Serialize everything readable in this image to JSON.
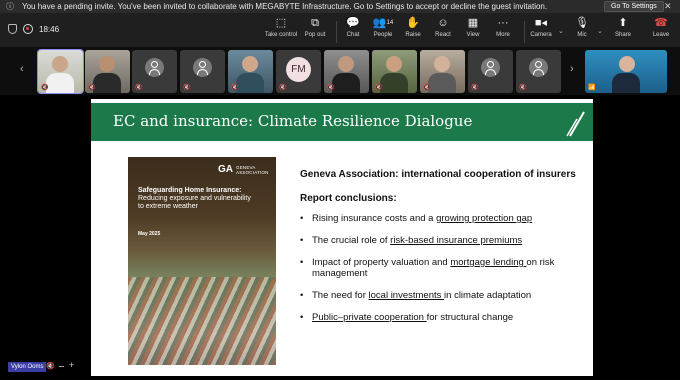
{
  "banner": {
    "message": "You have a pending invite. You've been invited to collaborate with MEGABYTE Infrastructure. Go to Settings to accept or decline the guest invitation.",
    "button": "Go To Settings"
  },
  "toolbar": {
    "time": "18:46",
    "take_control": "Take control",
    "pop_out": "Pop out",
    "chat": "Chat",
    "people": "People",
    "people_count": "14",
    "raise": "Raise",
    "react": "React",
    "view": "View",
    "more": "More",
    "camera": "Camera",
    "mic": "Mic",
    "share": "Share",
    "leave": "Leave"
  },
  "participants": {
    "initials": "FM",
    "presenter_name": "Vylon Ooms"
  },
  "slide": {
    "title": "EC and insurance: Climate Resilience Dialogue",
    "cover": {
      "logo_line1": "GENEVA",
      "logo_line2": "ASSOCIATION",
      "title_bold": "Safeguarding Home Insurance:",
      "title_rest": " Reducing exposure and vulnerability to extreme weather",
      "date": "May 2025"
    },
    "heading": "Geneva Association: international cooperation of insurers",
    "subheading": "Report conclusions:",
    "bullets": [
      {
        "pre": "Rising insurance costs and a ",
        "link": "growing protection gap",
        "post": ""
      },
      {
        "pre": "The crucial role of ",
        "link": "risk-based insurance premiums",
        "post": ""
      },
      {
        "pre": "Impact of property valuation and ",
        "link": "mortgage lending ",
        "post": "on risk management"
      },
      {
        "pre": "The need for ",
        "link": "local investments ",
        "post": "in climate adaptation"
      },
      {
        "pre": "",
        "link": "Public–private cooperation ",
        "post": "for structural change"
      }
    ]
  },
  "colors": {
    "slide_header": "#1c7a4a",
    "name_tag": "#3b3ea3",
    "leave": "#e24c4c"
  }
}
